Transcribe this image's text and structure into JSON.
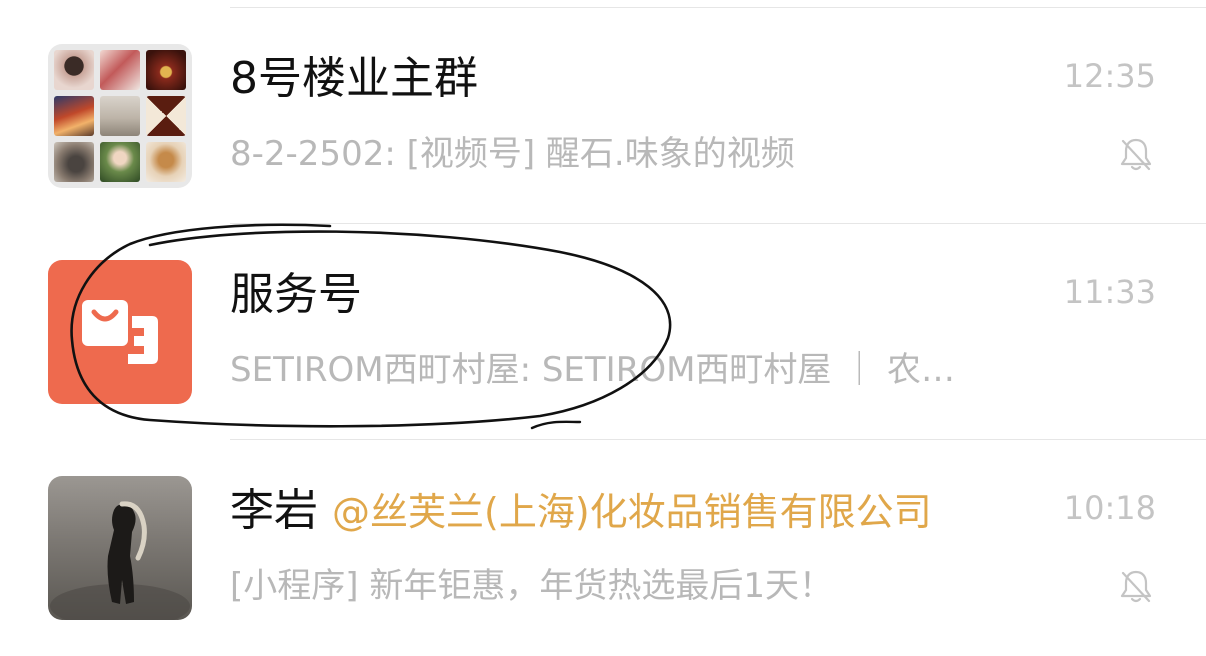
{
  "chats": [
    {
      "name": "8号楼业主群",
      "time": "12:35",
      "preview": "8-2-2502: [视频号] 醒石.味象的视频",
      "muted": true,
      "avatar_type": "group-grid"
    },
    {
      "name": "服务号",
      "time": "11:33",
      "preview": "SETIROM西町村屋: SETIROM西町村屋 ｜ 农…",
      "muted": false,
      "avatar_type": "service-account",
      "avatar_color": "#ee6a4e"
    },
    {
      "name": "李岩",
      "mention": "@丝芙兰(上海)化妆品销售有限公司",
      "time": "10:18",
      "preview": "[小程序] 新年钜惠，年货热选最后1天！",
      "muted": true,
      "avatar_type": "person-photo"
    }
  ],
  "colors": {
    "mention": "#e0a74a",
    "secondary_text": "#b8b8b8",
    "divider": "#e6e6e6",
    "annotation_ink": "#111111"
  },
  "icons": {
    "mute": "bell-slash-icon",
    "service": "shopping-bag-icon"
  }
}
